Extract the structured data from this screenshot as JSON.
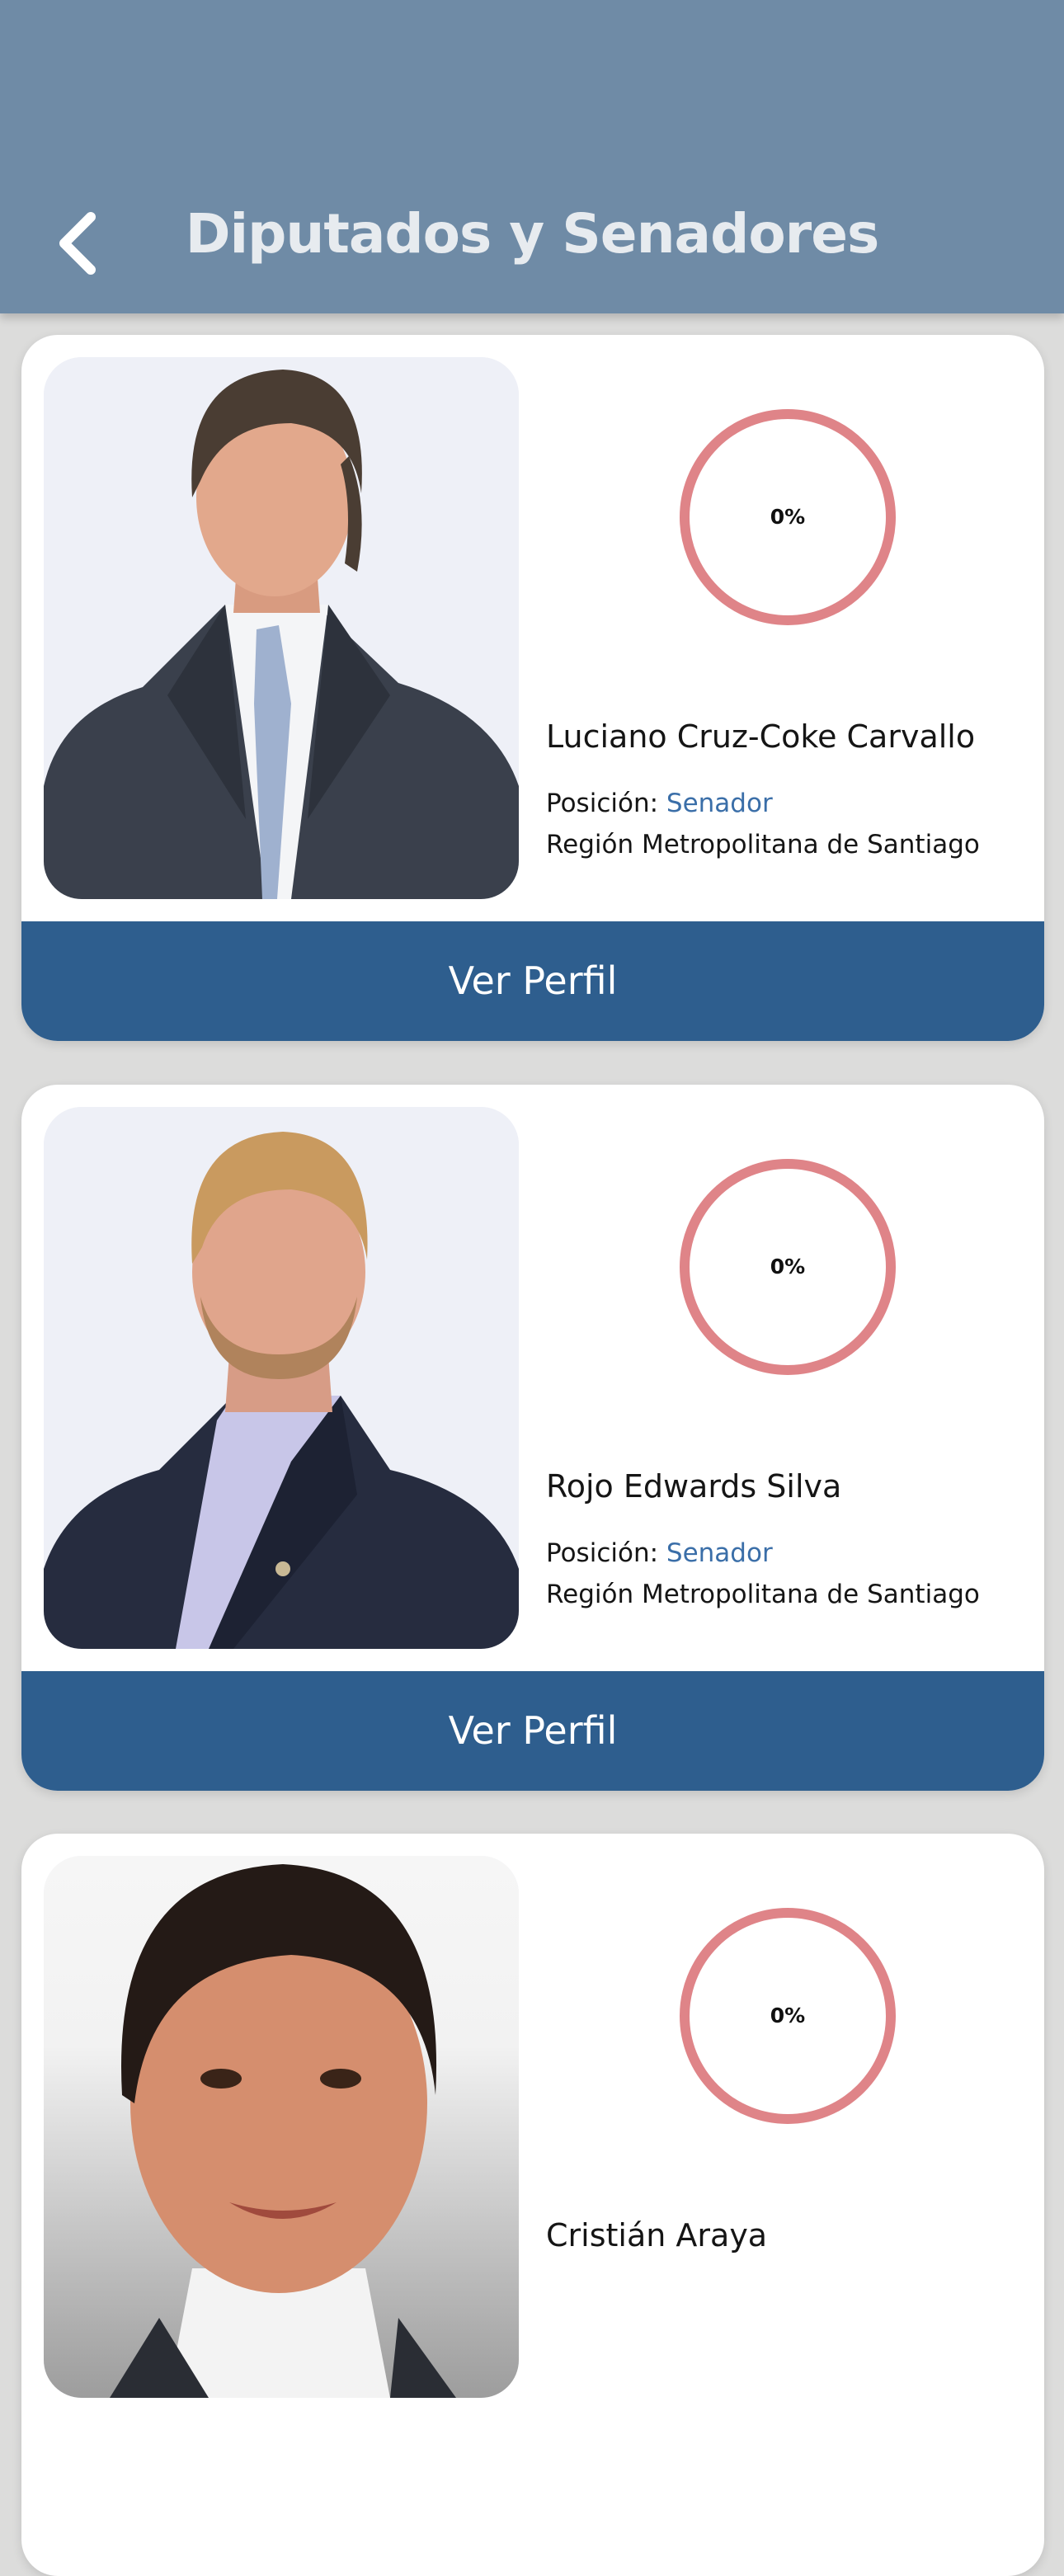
{
  "header": {
    "title": "Diputados y Senadores",
    "back_icon": "chevron-left-icon"
  },
  "colors": {
    "header_bg": "#6f8ba6",
    "button_bg": "#2e5e8e",
    "ring": "#df8488",
    "position_link": "#3a6ea8"
  },
  "people": [
    {
      "name": "Luciano Cruz-Coke Carvallo",
      "score": "0%",
      "position_label": "Posición:",
      "position_value": "Senador",
      "region": "Región Metropolitana de Santiago",
      "button_label": "Ver Perfil"
    },
    {
      "name": "Rojo Edwards Silva",
      "score": "0%",
      "position_label": "Posición:",
      "position_value": "Senador",
      "region": "Región Metropolitana de Santiago",
      "button_label": "Ver Perfil"
    },
    {
      "name": "Cristián Araya",
      "score": "0%",
      "position_label": "",
      "position_value": "",
      "region": "",
      "button_label": ""
    }
  ]
}
